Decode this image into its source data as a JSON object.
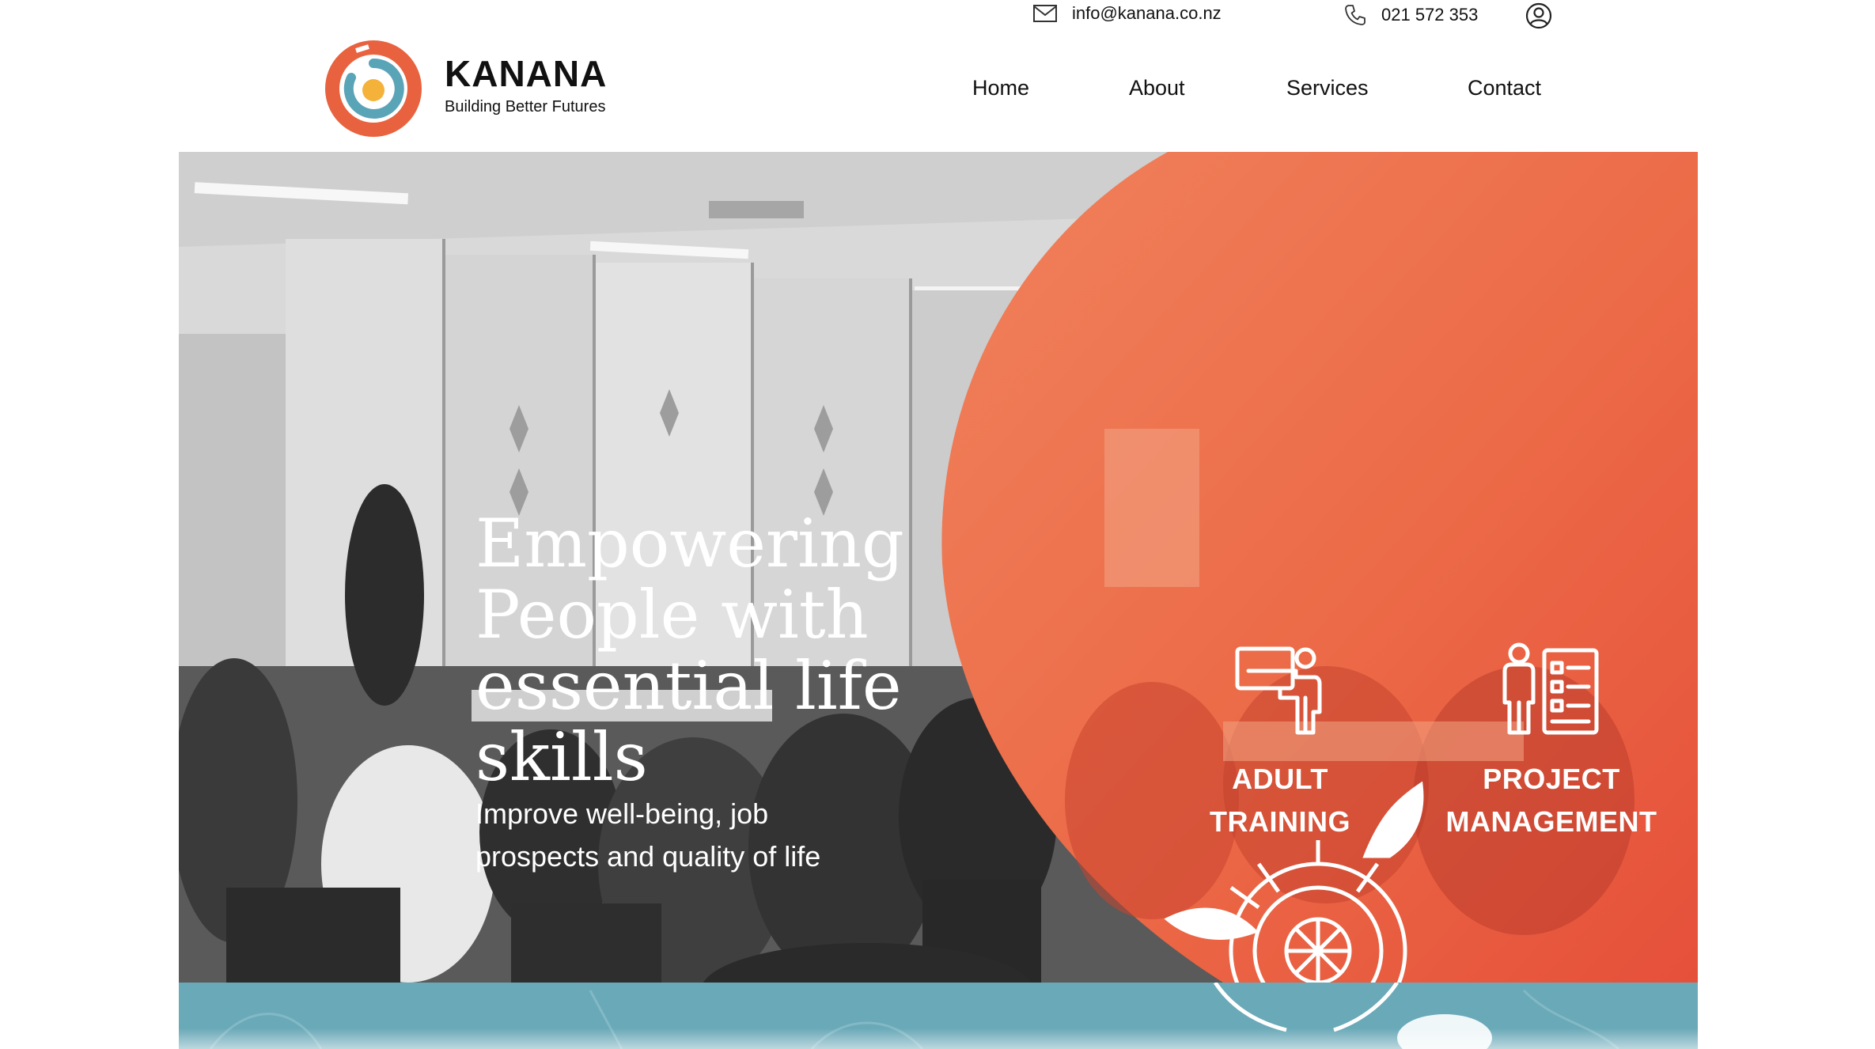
{
  "topbar": {
    "email": "info@kanana.co.nz",
    "phone": "021 572 353",
    "icons": [
      "envelope-icon",
      "phone-icon",
      "user-account-icon"
    ]
  },
  "brand": {
    "name": "KANANA",
    "tagline": "Building Better Futures"
  },
  "nav": {
    "items": [
      "Home",
      "About",
      "Services",
      "Contact"
    ]
  },
  "hero": {
    "title": "Empowering People with essential life skills",
    "subtitle": "Improve well-being, job prospects and quality of life"
  },
  "services": [
    {
      "line1": "ADULT",
      "line2": "TRAINING",
      "icon": "trainer-presentation-icon"
    },
    {
      "line1": "PROJECT",
      "line2": "MANAGEMENT",
      "icon": "person-checklist-icon"
    }
  ],
  "colors": {
    "accent_orange": "#e8623f",
    "accent_teal": "#5aa4b7",
    "logo_yellow": "#f5b23a",
    "teal_band": "#6aa9b8"
  }
}
